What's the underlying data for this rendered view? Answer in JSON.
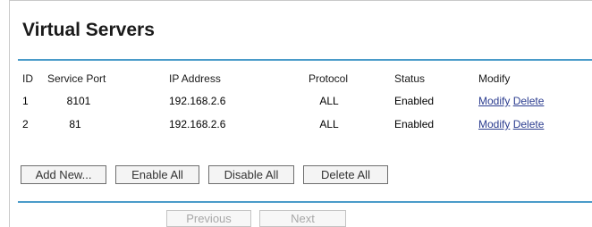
{
  "page": {
    "title": "Virtual Servers"
  },
  "table": {
    "headers": {
      "id": "ID",
      "service_port": "Service Port",
      "ip_address": "IP Address",
      "protocol": "Protocol",
      "status": "Status",
      "modify": "Modify"
    },
    "rows": [
      {
        "id": "1",
        "service_port": "8101",
        "ip_address": "192.168.2.6",
        "protocol": "ALL",
        "status": "Enabled",
        "modify_label": "Modify",
        "delete_label": "Delete"
      },
      {
        "id": "2",
        "service_port": "81",
        "ip_address": "192.168.2.6",
        "protocol": "ALL",
        "status": "Enabled",
        "modify_label": "Modify",
        "delete_label": "Delete"
      }
    ]
  },
  "actions": {
    "add_new": "Add New...",
    "enable_all": "Enable All",
    "disable_all": "Disable All",
    "delete_all": "Delete All"
  },
  "pagination": {
    "previous": "Previous",
    "next": "Next"
  },
  "colors": {
    "accent_rule": "#4a9bc9",
    "link": "#2b3c8f"
  }
}
